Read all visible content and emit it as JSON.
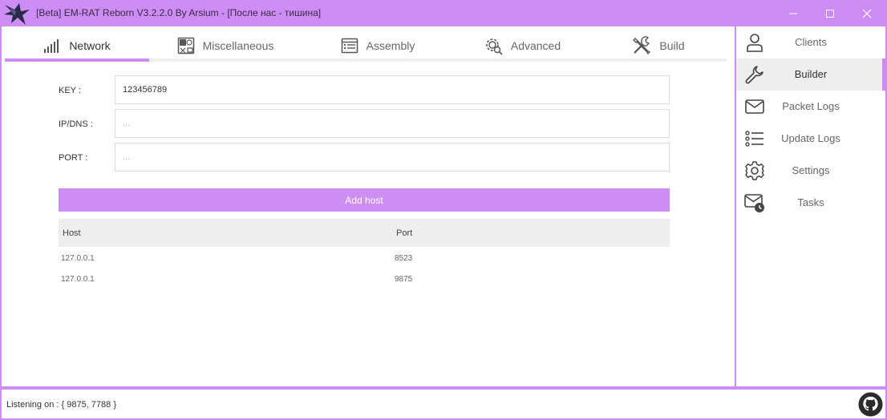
{
  "window": {
    "title": "[Beta] EM-RAT Reborn V3.2.2.0 By Arsium - [После нас - тишина]",
    "accent_color": "#cd8df5"
  },
  "tabs": [
    {
      "label": "Network",
      "icon": "signal-bars-icon",
      "active": true
    },
    {
      "label": "Miscellaneous",
      "icon": "misc-grid-icon"
    },
    {
      "label": "Assembly",
      "icon": "list-doc-icon"
    },
    {
      "label": "Advanced",
      "icon": "gear-search-icon"
    },
    {
      "label": "Build",
      "icon": "tools-icon"
    }
  ],
  "form": {
    "key_label": "KEY :",
    "key_value": "123456789",
    "ip_label": "IP/DNS :",
    "ip_placeholder": "...",
    "port_label": "PORT :",
    "port_placeholder": "..."
  },
  "add_host_label": "Add host",
  "hosts_table": {
    "columns": [
      "Host",
      "Port"
    ],
    "rows": [
      [
        "127.0.0.1",
        "8523"
      ],
      [
        "127.0.0.1",
        "9875"
      ]
    ]
  },
  "sidebar": {
    "items": [
      {
        "label": "Clients",
        "icon": "user-icon"
      },
      {
        "label": "Builder",
        "icon": "wrench-icon",
        "active": true
      },
      {
        "label": "Packet Logs",
        "icon": "envelope-icon"
      },
      {
        "label": "Update Logs",
        "icon": "list-icon"
      },
      {
        "label": "Settings",
        "icon": "gear-icon"
      },
      {
        "label": "Tasks",
        "icon": "mail-clock-icon"
      }
    ]
  },
  "status": {
    "text": "Listening on : { 9875, 7788 }"
  }
}
